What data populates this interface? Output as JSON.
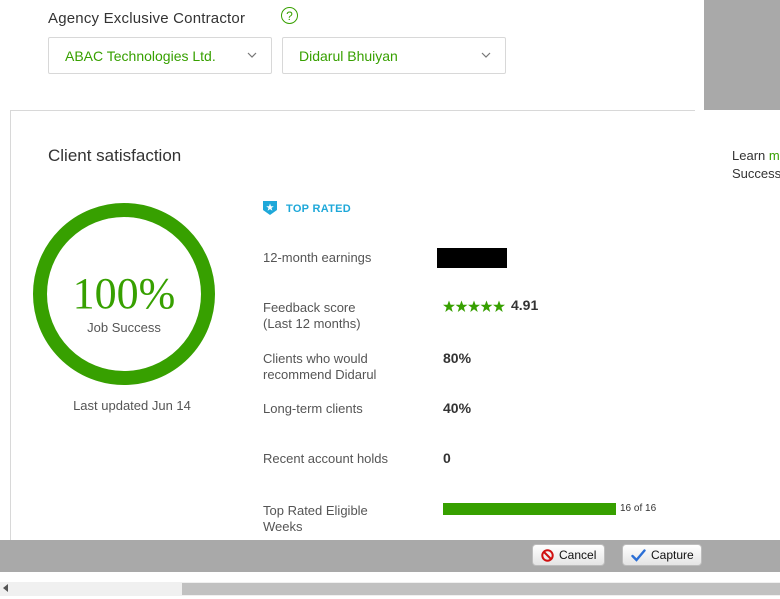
{
  "header": {
    "label": "Agency Exclusive Contractor",
    "help_glyph": "?",
    "agency_select": "ABAC Technologies Ltd.",
    "freelancer_select": "Didarul Bhuiyan"
  },
  "side": {
    "line1_prefix": "Learn ",
    "line1_link": "m",
    "line2": "Success"
  },
  "card": {
    "title": "Client satisfaction",
    "job_success_pct": "100%",
    "job_success_label": "Job Success",
    "job_success_fraction": 1.0,
    "last_updated": "Last updated Jun 14",
    "badge": "TOP RATED",
    "stats": {
      "earnings_label": "12-month earnings",
      "feedback_label_1": "Feedback score",
      "feedback_label_2": "(Last 12 months)",
      "feedback_value": "4.91",
      "recommend_label_1": "Clients who would",
      "recommend_label_2": "recommend Didarul",
      "recommend_value": "80%",
      "longterm_label": "Long-term clients",
      "longterm_value": "40%",
      "holds_label": "Recent account holds",
      "holds_value": "0",
      "eligible_label_1": "Top Rated Eligible",
      "eligible_label_2": "Weeks",
      "eligible_value": "16 of 16",
      "eligible_fraction": 1.0
    }
  },
  "buttons": {
    "cancel": "Cancel",
    "capture": "Capture"
  },
  "colors": {
    "accent_green": "#37a000",
    "badge_blue": "#1ea8d9"
  }
}
